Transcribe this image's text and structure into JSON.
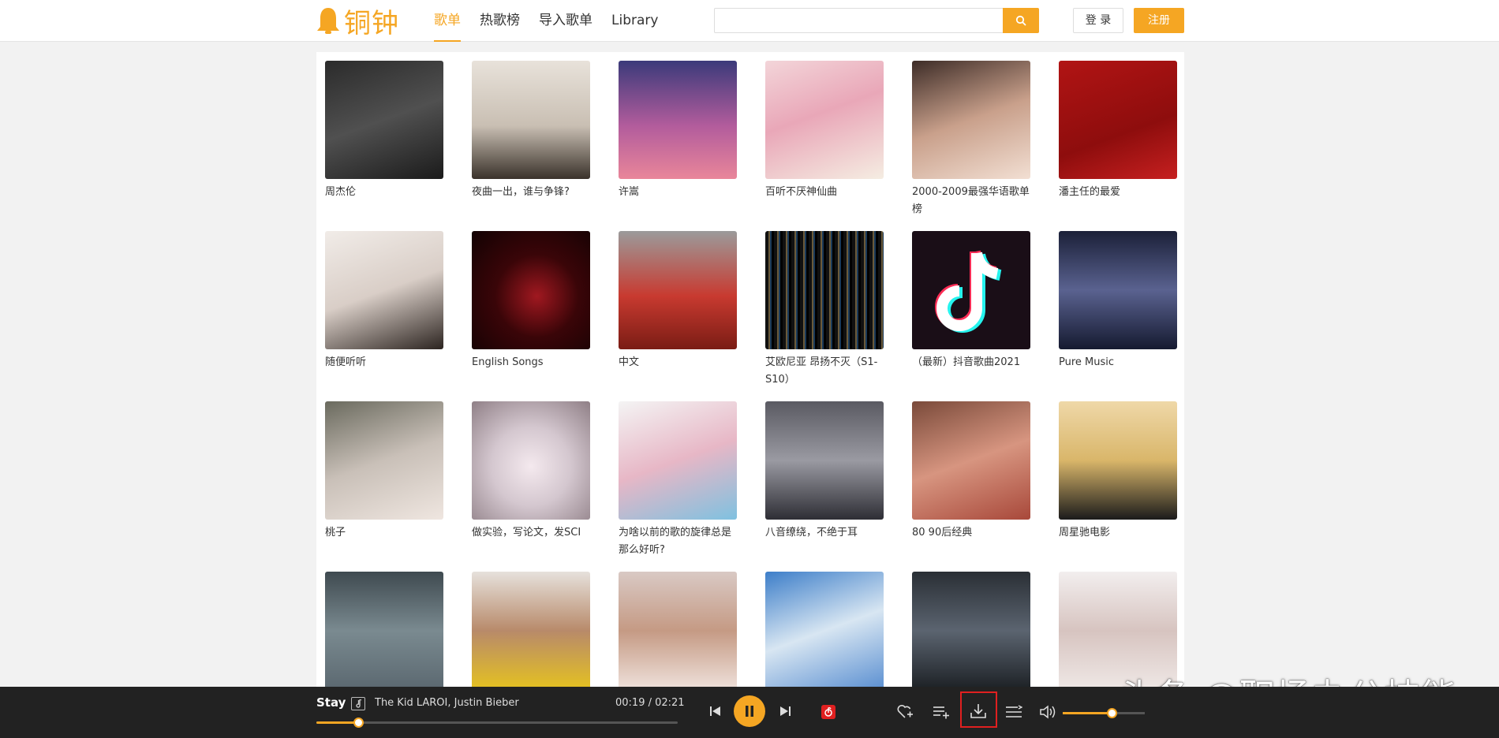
{
  "header": {
    "logo_text": "铜钟",
    "nav": [
      "歌单",
      "热歌榜",
      "导入歌单",
      "Library"
    ],
    "search_placeholder": "",
    "login_label": "登 录",
    "register_label": "注册"
  },
  "playlists": [
    {
      "title": "周杰伦",
      "bg": "linear-gradient(160deg,#2b2b2b,#505050 50%,#1b1b1b)"
    },
    {
      "title": "夜曲一出，谁与争锋?",
      "bg": "linear-gradient(180deg,#e8e2da,#c9bfb3 55%,#3a322b)"
    },
    {
      "title": "许嵩",
      "bg": "linear-gradient(180deg,#3b3a7a,#b25c9c 55%,#e9869a)"
    },
    {
      "title": "百听不厌神仙曲",
      "bg": "linear-gradient(160deg,#f3d5d9,#e9a7b8 45%,#f5ede2)"
    },
    {
      "title": "2000-2009最强华语歌单榜",
      "bg": "linear-gradient(160deg,#3d2c27,#c9a08b 50%,#f2dfd3)"
    },
    {
      "title": "潘主任的最爱",
      "bg": "linear-gradient(160deg,#b11414,#8e0d0d 60%,#c62020)"
    },
    {
      "title": "随便听听",
      "bg": "linear-gradient(160deg,#f1ece8,#d9cec7 50%,#2c2420)"
    },
    {
      "title": "English Songs",
      "bg": "radial-gradient(circle at 55% 55%,#a01820,#3a0508 45%,#120203)"
    },
    {
      "title": "中文",
      "bg": "linear-gradient(180deg,#9b9b9b,#c83a30 55%,#7a1c14)"
    },
    {
      "title": "艾欧尼亚 昂扬不灭（S1-S10）",
      "bg": "repeating-linear-gradient(90deg,#111 0 4px,#6a5a3a 4px 6px,#1a3a5a 6px 8px,#000 8px 11px)"
    },
    {
      "title": "（最新）抖音歌曲2021",
      "bg": "#1a0e17"
    },
    {
      "title": "Pure Music",
      "bg": "linear-gradient(180deg,#1b2038,#5a6290 50%,#151a30)"
    },
    {
      "title": "桃子",
      "bg": "linear-gradient(160deg,#6a6a5e,#c9c0b8 50%,#efe6e0)"
    },
    {
      "title": "做实验，写论文，发SCI",
      "bg": "radial-gradient(circle at 50% 55%,#f4e9ee,#d4c7cf 45%,#8f7f86)"
    },
    {
      "title": "为啥以前的歌的旋律总是那么好听?",
      "bg": "linear-gradient(160deg,#f4f4f4,#e7b7c6 50%,#7fc1e0)"
    },
    {
      "title": "八音缭绕，不绝于耳",
      "bg": "linear-gradient(180deg,#5a5a62,#9a9aa2 50%,#2e2e35)"
    },
    {
      "title": "80 90后经典",
      "bg": "linear-gradient(160deg,#7a4a3a,#d79580 50%,#a8483a)"
    },
    {
      "title": "周星驰电影",
      "bg": "linear-gradient(180deg,#efd8a8,#d9b66a 50%,#1b1b1b)"
    },
    {
      "title": "",
      "bg": "linear-gradient(180deg,#3f4a50,#7a8a90 50%,#5b6870)"
    },
    {
      "title": "",
      "bg": "linear-gradient(180deg,#e6e1dc,#b88a6a 50%,#e5c220)"
    },
    {
      "title": "",
      "bg": "linear-gradient(180deg,#d9c9c4,#c59a84 50%,#efe2dc)"
    },
    {
      "title": "",
      "bg": "linear-gradient(160deg,#3d7ec9,#d8e6f2 50%,#5a8fd1)"
    },
    {
      "title": "",
      "bg": "linear-gradient(180deg,#2a2f35,#5b6470 50%,#1c2024)"
    },
    {
      "title": "",
      "bg": "linear-gradient(180deg,#f2eeee,#d7c4c0 50%,#efe8e6)"
    }
  ],
  "player": {
    "song": "Stay",
    "artist": "The Kid LAROI, Justin Bieber",
    "time": "00:19 / 02:21",
    "progress": 0.115,
    "volume": 0.6
  },
  "watermark": "头条 @职场办公技能",
  "colors": {
    "accent": "#f5a623",
    "player_bg": "#222222",
    "highlight": "#e02020"
  }
}
